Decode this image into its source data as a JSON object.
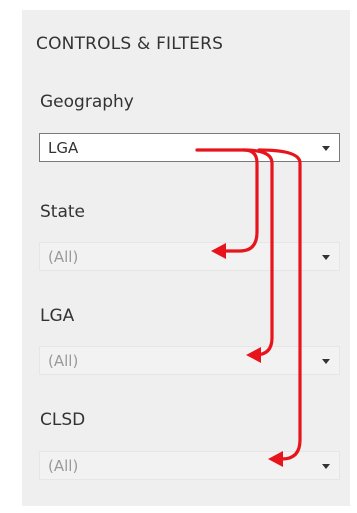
{
  "panel": {
    "title": "CONTROLS & FILTERS"
  },
  "filters": [
    {
      "label": "Geography",
      "value": "LGA"
    },
    {
      "label": "State",
      "value": "(All)"
    },
    {
      "label": "LGA",
      "value": "(All)"
    },
    {
      "label": "CLSD",
      "value": "(All)"
    }
  ],
  "annotation": {
    "arrow_color": "#e8141c"
  }
}
